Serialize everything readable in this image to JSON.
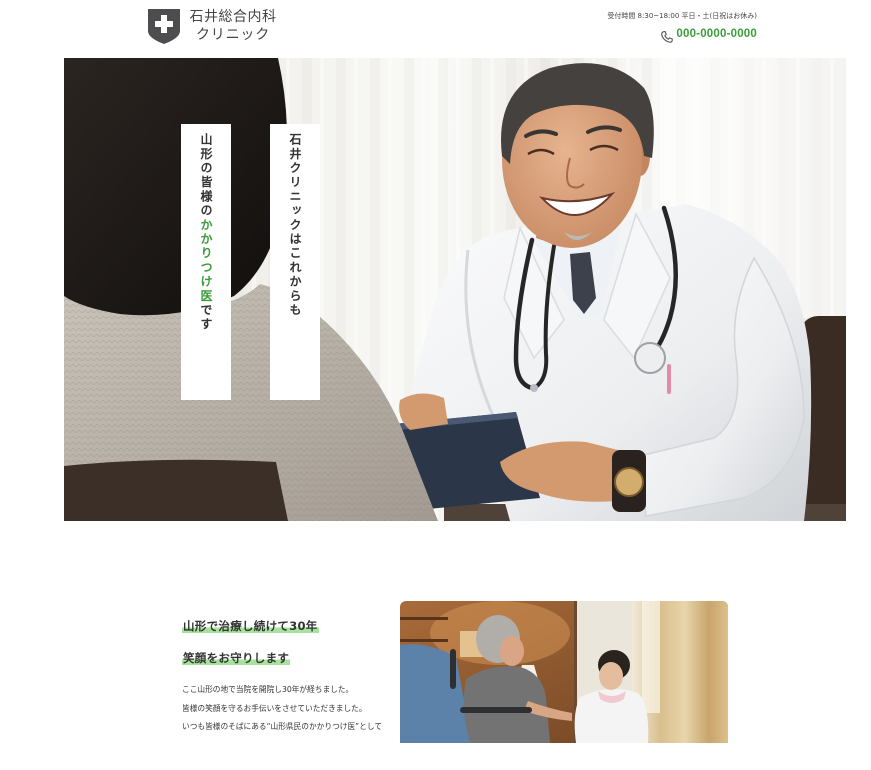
{
  "header": {
    "logo_icon": "cross-shield-icon",
    "clinic_name_line1": "石井総合内科",
    "clinic_name_line2": "クリニック",
    "hours": "受付時間 8:30~18:00 平日・土(日祝はお休み)",
    "phone_icon": "phone-icon",
    "phone": "000-0000-0000"
  },
  "hero": {
    "catch_right": "石井クリニックはこれからも",
    "catch_left_before": "山形の皆様の",
    "catch_left_highlight": "かかりつけ医",
    "catch_left_after": "です"
  },
  "intro": {
    "heading1": "山形で治療し続けて30年",
    "heading2": "笑顔をお守りします",
    "paragraphs": [
      "ここ山形の地で当院を開院し30年が経ちました。",
      "皆様の笑顔を守るお手伝いをさせていただきました。",
      "いつも皆様のそばにある“山形県民のかかりつけ医”として"
    ]
  },
  "colors": {
    "accent": "#3a9d3a",
    "highlight": "#a6e29b",
    "text": "#333333",
    "logo": "#4d4d4f"
  }
}
